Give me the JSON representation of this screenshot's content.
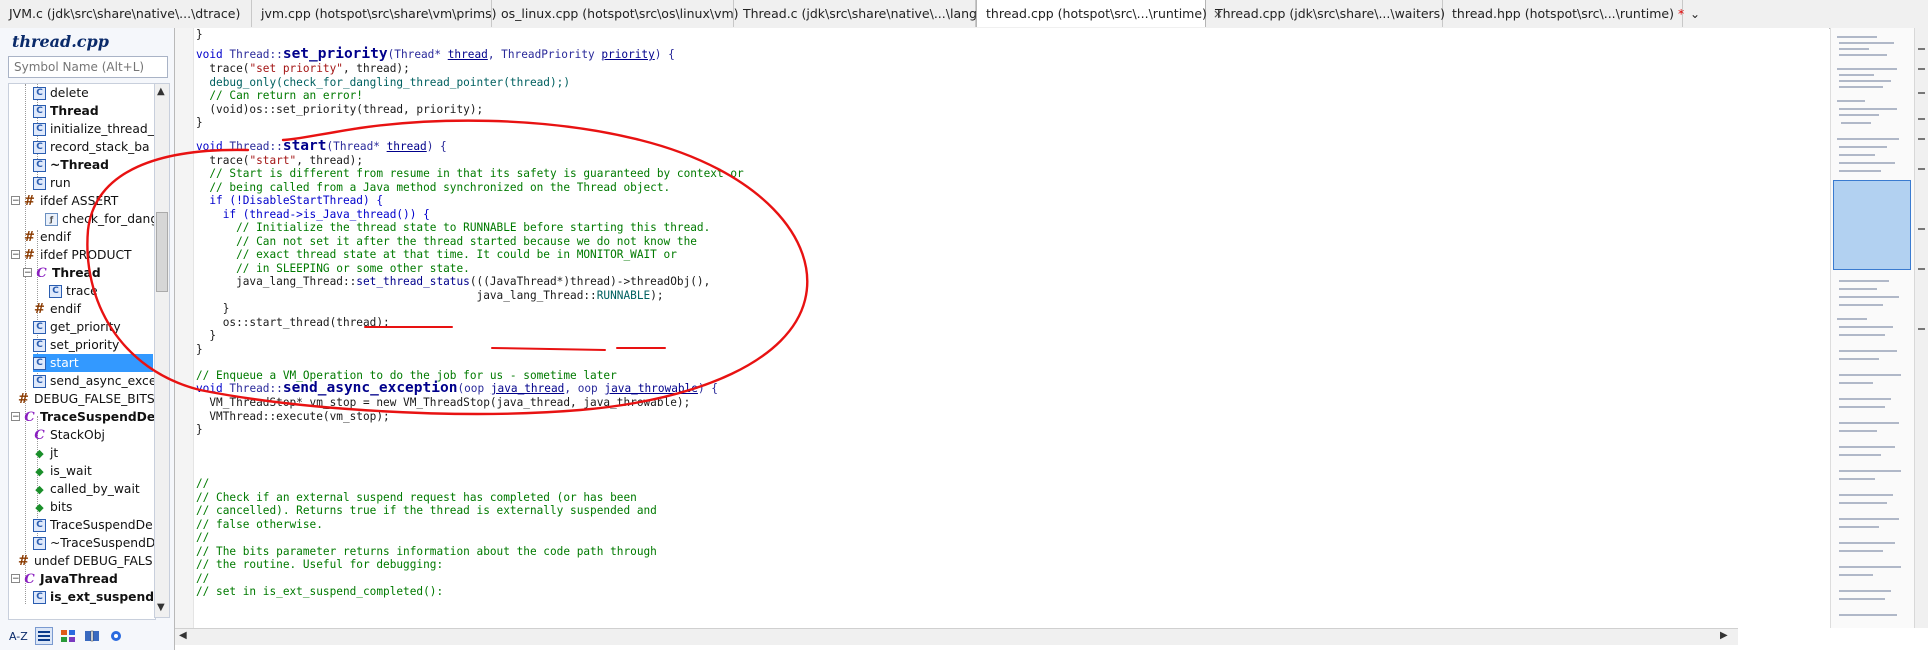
{
  "tabs": [
    {
      "label": "JVM.c (jdk\\src\\share\\native\\...\\dtrace)",
      "active": false
    },
    {
      "label": "jvm.cpp (hotspot\\src\\share\\vm\\prims)",
      "active": false
    },
    {
      "label": "os_linux.cpp (hotspot\\src\\os\\linux\\vm)",
      "active": false
    },
    {
      "label": "Thread.c (jdk\\src\\share\\native\\...\\lang)",
      "active": false
    },
    {
      "label": "thread.cpp (hotspot\\src\\...\\runtime)",
      "active": true,
      "close": "×"
    },
    {
      "label": "Thread.cpp (jdk\\src\\share\\...\\waiters)",
      "active": false
    },
    {
      "label": "thread.hpp (hotspot\\src\\...\\runtime)",
      "active": false,
      "modified": "*"
    }
  ],
  "tab_dropdown": "⌄",
  "outline": {
    "title": "thread.cpp",
    "search_placeholder": "Symbol Name (Alt+L)",
    "items": [
      {
        "label": "delete"
      },
      {
        "label": "Thread"
      },
      {
        "label": "initialize_thread_l"
      },
      {
        "label": "record_stack_ba"
      },
      {
        "label": "~Thread"
      },
      {
        "label": "run"
      },
      {
        "label": "ifdef ASSERT"
      },
      {
        "label": "check_for_dangli"
      },
      {
        "label": "endif"
      },
      {
        "label": "ifdef PRODUCT"
      },
      {
        "label": "Thread"
      },
      {
        "label": "trace"
      },
      {
        "label": "endif"
      },
      {
        "label": "get_priority"
      },
      {
        "label": "set_priority"
      },
      {
        "label": "start"
      },
      {
        "label": "send_async_exce"
      },
      {
        "label": "DEBUG_FALSE_BITS"
      },
      {
        "label": "TraceSuspendDeb"
      },
      {
        "label": "StackObj"
      },
      {
        "label": "jt"
      },
      {
        "label": "is_wait"
      },
      {
        "label": "called_by_wait"
      },
      {
        "label": "bits"
      },
      {
        "label": "TraceSuspendDe"
      },
      {
        "label": "~TraceSuspendD"
      },
      {
        "label": "undef DEBUG_FALS"
      },
      {
        "label": "JavaThread"
      },
      {
        "label": "is_ext_suspend"
      }
    ],
    "toolbar": {
      "sort": "A-Z"
    }
  },
  "code": {
    "l00": "}",
    "l02_ret": "void",
    "l02_cls": "Thread::",
    "l02_fn": "set_priority",
    "l02_rest1": "(Thread* ",
    "l02_p1": "thread",
    "l02_rest2": ", ThreadPriority ",
    "l02_p2": "priority",
    "l02_rest3": ") {",
    "l03_a": "  trace(",
    "l03_s": "\"set priority\"",
    "l03_b": ", thread);",
    "l04": "  debug_only(check_for_dangling_thread_pointer(thread);)",
    "l05": "  // Can return an error!",
    "l06": "  (void)os::set_priority(thread, priority);",
    "l07": "}",
    "l09_ret": "void",
    "l09_cls": "Thread::",
    "l09_fn": "start",
    "l09_rest1": "(Thread* ",
    "l09_p1": "thread",
    "l09_rest2": ") {",
    "l10_a": "  trace(",
    "l10_s": "\"start\"",
    "l10_b": ", thread);",
    "l11": "  // Start is different from resume in that its safety is guaranteed by context or",
    "l12": "  // being called from a Java method synchronized on the Thread object.",
    "l13": "  if (!DisableStartThread) {",
    "l14": "    if (thread->is_Java_thread()) {",
    "l15": "      // Initialize the thread state to RUNNABLE before starting this thread.",
    "l16": "      // Can not set it after the thread started because we do not know the",
    "l17": "      // exact thread state at that time. It could be in MONITOR_WAIT or",
    "l18": "      // in SLEEPING or some other state.",
    "l19_a": "      java_lang_Thread::",
    "l19_b": "set_thread_status",
    "l19_c": "(((JavaThread*)thread)->threadObj(),",
    "l20_a": "                                          java_lang_Thread::",
    "l20_b": "RUNNABLE",
    "l20_c": ");",
    "l21": "    }",
    "l22": "    os::start_thread(thread);",
    "l23": "  }",
    "l24": "}",
    "l26": "// Enqueue a VM_Operation to do the job for us - sometime later",
    "l27_ret": "void",
    "l27_cls": "Thread::",
    "l27_fn": "send_async_exception",
    "l27_rest1": "(oop ",
    "l27_p1": "java_thread",
    "l27_rest2": ", oop ",
    "l27_p2": "java_throwable",
    "l27_rest3": ") {",
    "l28": "  VM_ThreadStop* vm_stop = new VM_ThreadStop(java_thread, java_throwable);",
    "l29": "  VMThread::execute(vm_stop);",
    "l30": "}",
    "l34": "//",
    "l35": "// Check if an external suspend request has completed (or has been",
    "l36": "// cancelled). Returns true if the thread is externally suspended and",
    "l37": "// false otherwise.",
    "l38": "//",
    "l39": "// The bits parameter returns information about the code path through",
    "l40": "// the routine. Useful for debugging:",
    "l41": "//",
    "l42": "// set in is_ext_suspend_completed():"
  }
}
